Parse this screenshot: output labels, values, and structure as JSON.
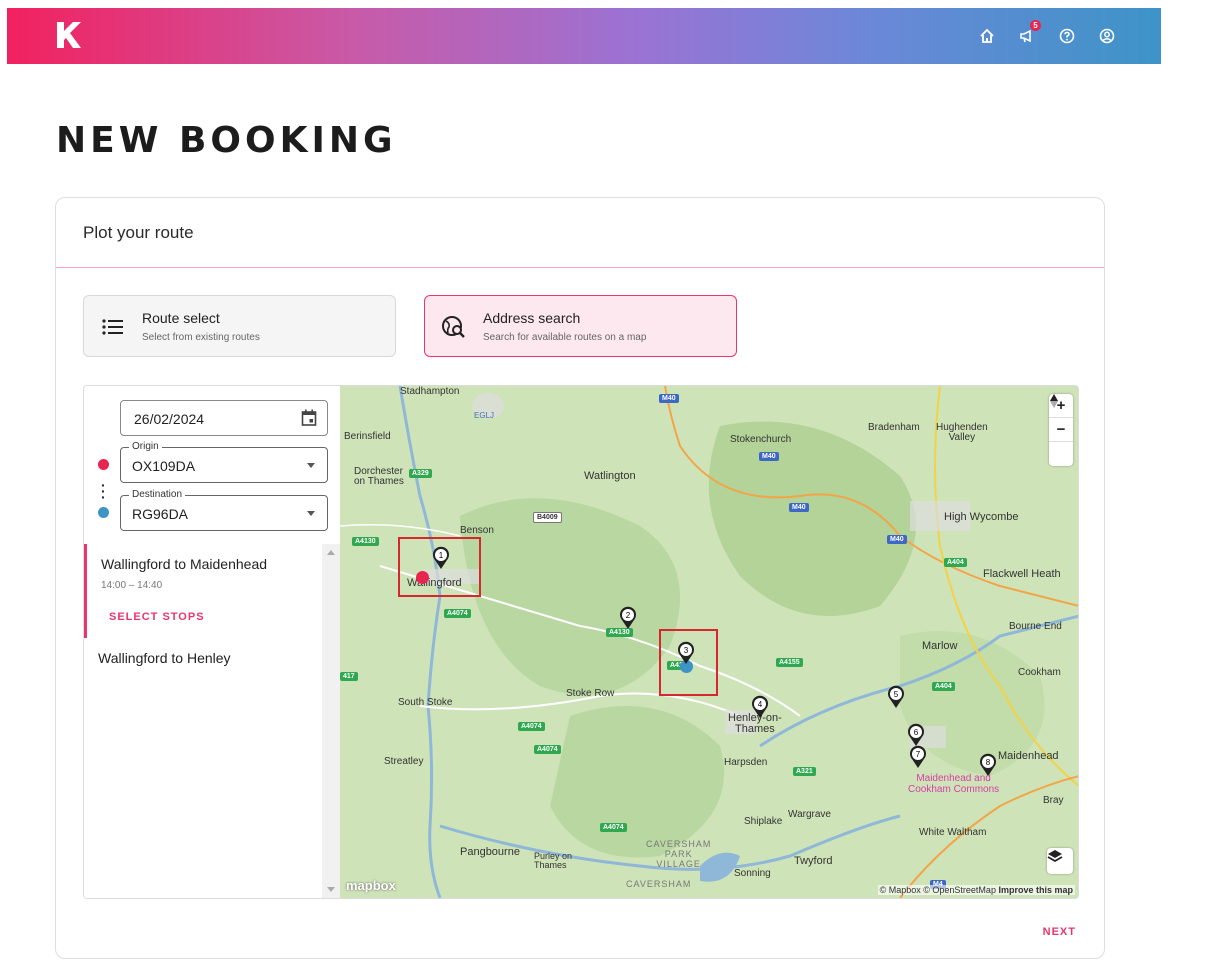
{
  "header": {
    "notification_count": "5",
    "icons": [
      "home-icon",
      "megaphone-icon",
      "help-icon",
      "account-icon"
    ]
  },
  "page": {
    "title": "NEW BOOKING"
  },
  "card": {
    "title": "Plot your route",
    "options": [
      {
        "title": "Route select",
        "subtitle": "Select from existing routes",
        "icon": "list-icon"
      },
      {
        "title": "Address search",
        "subtitle": "Search for available routes on a map",
        "icon": "globe-search-icon"
      }
    ],
    "next_label": "NEXT"
  },
  "form": {
    "date": "26/02/2024",
    "origin_label": "Origin",
    "origin_value": "OX109DA",
    "destination_label": "Destination",
    "destination_value": "RG96DA",
    "origin_color": "#e8254f",
    "destination_color": "#3d94c7"
  },
  "routes": [
    {
      "name": "Wallingford to Maidenhead",
      "time": "14:00 – 14:40",
      "action": "SELECT STOPS"
    },
    {
      "name": "Wallingford to Henley"
    }
  ],
  "map": {
    "places": {
      "stadhampton": "Stadhampton",
      "eglj": "EGLJ",
      "berinsfield": "Berinsfield",
      "dorchester": "Dorchester\non Thames",
      "watlington": "Watlington",
      "stokenchurch": "Stokenchurch",
      "bradenham": "Bradenham",
      "hughenden": "Hughenden\nValley",
      "high_wycombe": "High Wycombe",
      "benson": "Benson",
      "wallingford": "Wallingford",
      "flackwell": "Flackwell Heath",
      "bourne_end": "Bourne End",
      "marlow": "Marlow",
      "cookham": "Cookham",
      "south_stoke": "South Stoke",
      "stoke_row": "Stoke Row",
      "henley": "Henley-on-\nThames",
      "maidenhead": "Maidenhead",
      "streatley": "Streatley",
      "harpsden": "Harpsden",
      "maidenhead_commons": "Maidenhead and\nCookham Commons",
      "bray": "Bray",
      "wargrave": "Wargrave",
      "shiplake": "Shiplake",
      "white_waltham": "White Waltham",
      "caversham_park": "CAVERSHAM\nPARK\nVILLAGE",
      "pangbourne": "Pangbourne",
      "purley": "Purley on\nThames",
      "sonning": "Sonning",
      "twyford": "Twyford",
      "caversham": "CAVERSHAM"
    },
    "roads": {
      "m40a": "M40",
      "m40b": "M40",
      "m40c": "M40",
      "m40d": "M40",
      "a329": "A329",
      "b4009": "B4009",
      "a4130a": "A4130",
      "a4074a": "A4074",
      "a4130b": "A4130",
      "a4155": "A4155",
      "a404a": "A404",
      "a404b": "A404",
      "a417": "417",
      "a4074b": "A4074",
      "a4074c": "A4074",
      "a321": "A321",
      "a4074d": "A4074",
      "m4": "M4",
      "a41": "A41"
    },
    "stops": [
      "1",
      "2",
      "3",
      "4",
      "5",
      "6",
      "7",
      "8"
    ],
    "attribution": "© Mapbox © OpenStreetMap",
    "improve": "Improve this map",
    "logo": "mapbox"
  }
}
